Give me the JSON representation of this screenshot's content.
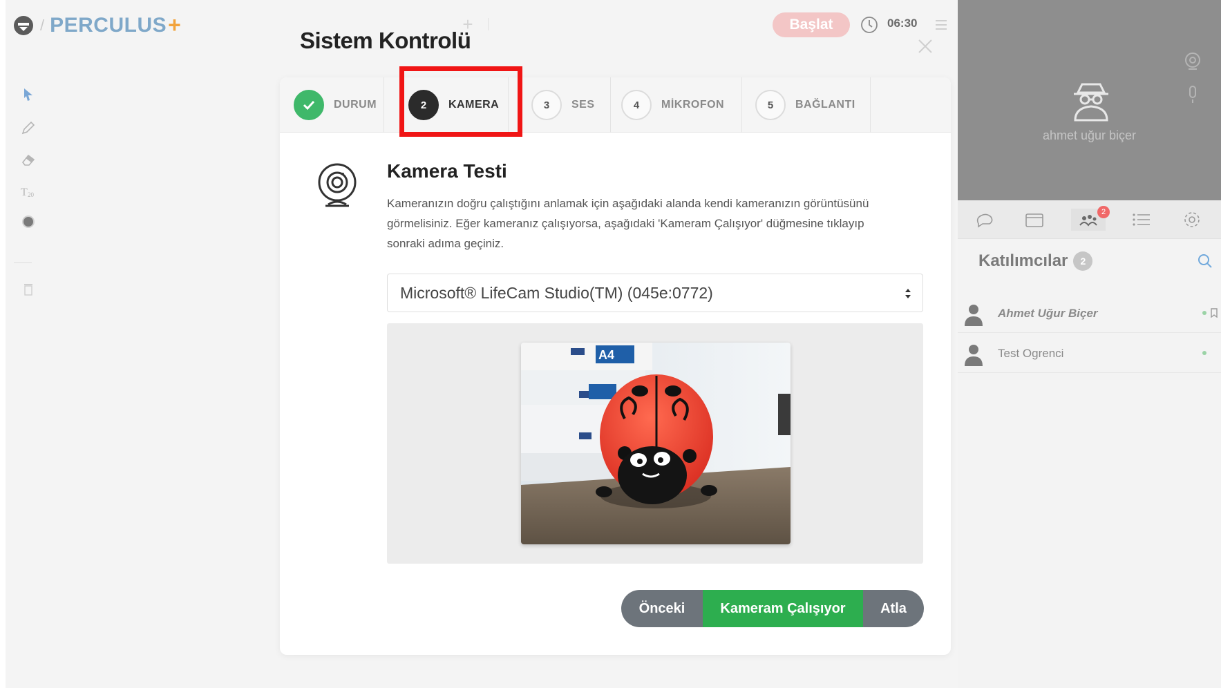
{
  "app": {
    "logo_text": "PERCULUS",
    "logo_plus": "+",
    "start_label": "Başlat",
    "timer": "06:30",
    "add_tab": "+"
  },
  "modal": {
    "title": "Sistem Kontrolü",
    "steps": [
      {
        "number": "",
        "label": "DURUM",
        "state": "done"
      },
      {
        "number": "2",
        "label": "KAMERA",
        "state": "current"
      },
      {
        "number": "3",
        "label": "SES",
        "state": "pending"
      },
      {
        "number": "4",
        "label": "MİKROFON",
        "state": "pending"
      },
      {
        "number": "5",
        "label": "BAĞLANTI",
        "state": "pending"
      }
    ],
    "section_title": "Kamera Testi",
    "description": "Kameranızın doğru çalıştığını anlamak için aşağıdaki alanda kendi kameranızın görüntüsünü görmelisiniz. Eğer kameranız çalışıyorsa, aşağıdaki 'Kameram Çalışıyor' düğmesine tıklayıp sonraki adıma geçiniz.",
    "camera_select_value": "Microsoft® LifeCam Studio(TM) (045e:0772)",
    "buttons": {
      "prev": "Önceki",
      "confirm": "Kameram Çalışıyor",
      "skip": "Atla"
    }
  },
  "right_panel": {
    "video_user_name": "ahmet uğur biçer",
    "participants_badge": "2",
    "participants_title": "Katılımcılar",
    "participants_count": "2",
    "participants": [
      {
        "name": "Ahmet Uğur Biçer",
        "style": "italic"
      },
      {
        "name": "Test Ogrenci",
        "style": "normal"
      }
    ]
  },
  "colors": {
    "accent_green": "#2dae4f",
    "highlight_red": "#f01515",
    "start_button": "#f3c6c6",
    "logo_blue": "#7fa8c9",
    "logo_orange": "#f2a33c"
  }
}
